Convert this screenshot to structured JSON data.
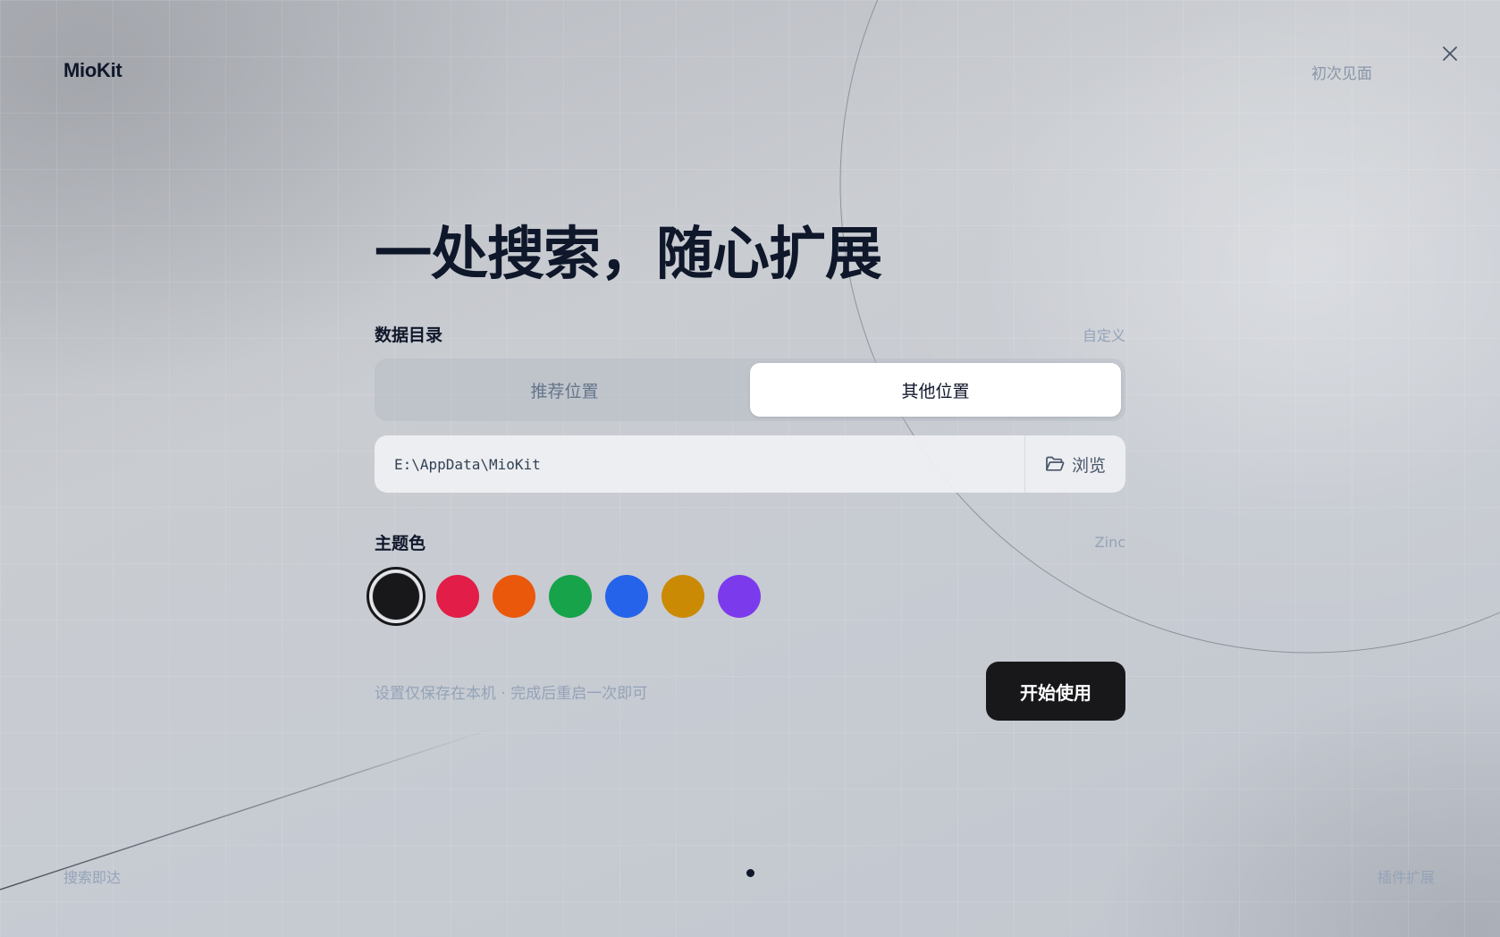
{
  "brand": "MioKit",
  "header": {
    "step_label": "初次见面"
  },
  "main": {
    "headline": "一处搜索，随心扩展",
    "data_dir": {
      "label": "数据目录",
      "hint": "自定义",
      "options": [
        "推荐位置",
        "其他位置"
      ],
      "selected": "其他位置",
      "path_value": "E:\\AppData\\MioKit",
      "browse_label": "浏览"
    },
    "theme": {
      "label": "主题色",
      "selected_name": "Zinc",
      "colors": [
        "#18181b",
        "#e11d48",
        "#ea580c",
        "#16a34a",
        "#2563eb",
        "#ca8a04",
        "#7c3aed"
      ]
    },
    "note": "设置仅保存在本机 · 完成后重启一次即可",
    "start_button": "开始使用"
  },
  "footer": {
    "left_label": "搜索即达",
    "right_label": "插件扩展",
    "page_dots": 1,
    "current_page": 1
  }
}
